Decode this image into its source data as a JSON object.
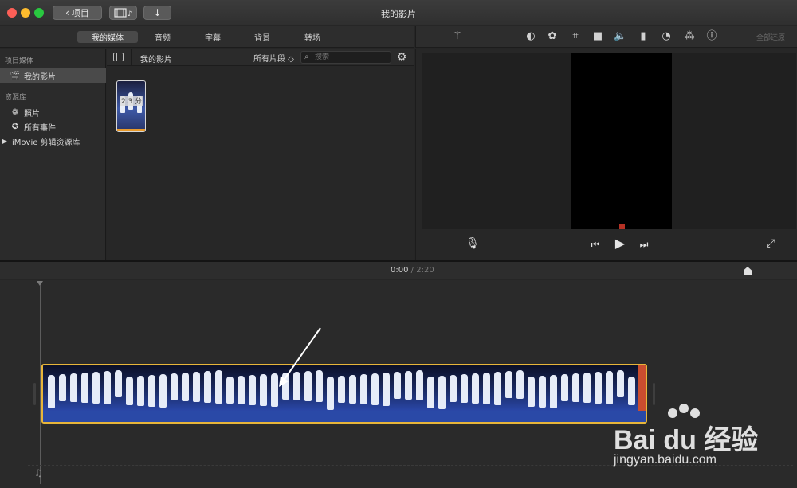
{
  "window": {
    "title": "我的影片",
    "projects_button": "项目"
  },
  "tabs": [
    "我的媒体",
    "音频",
    "字幕",
    "背景",
    "转场"
  ],
  "sidebar": {
    "section_project_media": "项目媒体",
    "item_my_movie": "我的影片",
    "section_libraries": "资源库",
    "item_photos": "照片",
    "item_all_events": "所有事件",
    "item_imovie_library": "iMovie 剪辑资源库"
  },
  "browser": {
    "title": "我的影片",
    "clip_filter": "所有片段 ◇",
    "search_placeholder": "搜索",
    "clip_duration": "2.3 分"
  },
  "viewer": {
    "reset_all": "全部还原"
  },
  "timeline": {
    "current_time": "0:00",
    "separator": "/",
    "total_time": "2:20"
  },
  "watermark": {
    "brand": "Bai du 经验",
    "url": "jingyan.baidu.com"
  },
  "icons": [
    "magic-wand-icon",
    "color-balance-icon",
    "color-correction-icon",
    "crop-icon",
    "stabilization-icon",
    "volume-icon",
    "equalizer-icon",
    "speed-icon",
    "filter-icon",
    "info-icon",
    "microphone-icon",
    "skip-back-icon",
    "play-icon",
    "skip-forward-icon",
    "fullscreen-icon",
    "music-note-icon"
  ]
}
